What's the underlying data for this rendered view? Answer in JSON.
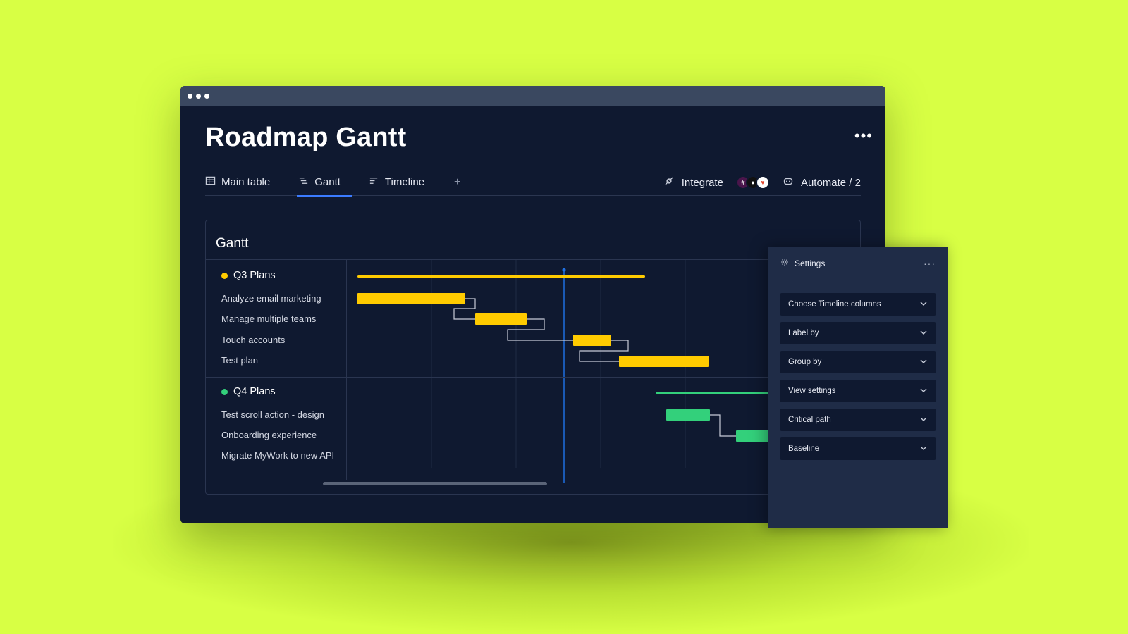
{
  "page": {
    "title": "Roadmap Gantt"
  },
  "tabs": [
    {
      "label": "Main table",
      "icon": "table-icon",
      "active": false
    },
    {
      "label": "Gantt",
      "icon": "gantt-icon",
      "active": true
    },
    {
      "label": "Timeline",
      "icon": "timeline-icon",
      "active": false
    }
  ],
  "toolbar": {
    "add_tab": "+",
    "integrate_label": "Integrate",
    "automate_label": "Automate / 2"
  },
  "gantt": {
    "title": "Gantt",
    "groups": [
      {
        "name": "Q3 Plans",
        "color": "#ffcb00",
        "items": [
          "Analyze email marketing",
          "Manage multiple teams",
          "Touch accounts",
          "Test plan"
        ]
      },
      {
        "name": "Q4 Plans",
        "color": "#33d07b",
        "items": [
          "Test scroll action - design",
          "Onboarding experience",
          "Migrate MyWork to new API"
        ]
      }
    ],
    "today_marker_color": "#1f6fe0"
  },
  "settings": {
    "title": "Settings",
    "dropdowns": [
      "Choose Timeline columns",
      "Label by",
      "Group by",
      "View settings",
      "Critical path",
      "Baseline"
    ]
  },
  "colors": {
    "background": "#d8ff44",
    "window": "#0f1930",
    "q3": "#ffcb00",
    "q4": "#33d07b",
    "accent": "#3b7bff"
  }
}
